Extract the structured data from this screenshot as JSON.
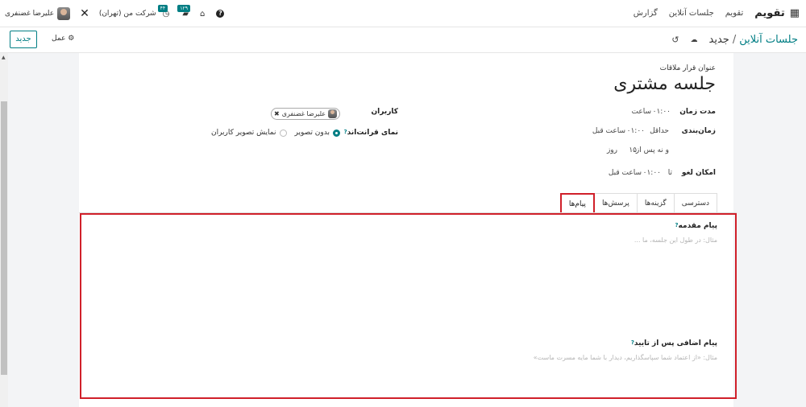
{
  "navbar": {
    "app_name": "تقویم",
    "menu": [
      "تقویم",
      "جلسات آنلاین",
      "گزارش"
    ],
    "user_name": "علیرضا غضنفری",
    "company": "شرکت من (تهران)",
    "activity_count": "۴۴",
    "messages_count": "۱۲۹"
  },
  "control": {
    "breadcrumb_parent": "جلسات آنلاین",
    "breadcrumb_sep": "/",
    "breadcrumb_current": "جدید",
    "new_label": "جدید",
    "action_label": "عمل"
  },
  "form": {
    "title_label": "عنوان قرار ملاقات",
    "title_value": "جلسه مشتری",
    "duration_label": "مدت زمان",
    "duration_value": "۰۱:۰۰",
    "duration_unit": "ساعت",
    "scheduling_label": "زمان‌بندی",
    "scheduling_min_prefix": "حداقل",
    "scheduling_min_value": "۰۱:۰۰",
    "scheduling_min_unit": "ساعت قبل",
    "scheduling_max_prefix": "و نه پس از",
    "scheduling_max_value": "۱۵",
    "scheduling_max_unit": "روز",
    "cancel_label": "امکان لغو",
    "cancel_prefix": "تا",
    "cancel_value": "۰۱:۰۰",
    "cancel_unit": "ساعت قبل",
    "users_label": "کاربران",
    "user_tag": "علیرضا غضنفری",
    "front_label": "نمای قرانت‌اند",
    "radio_no_image": "بدون تصویر",
    "radio_show_image": "نمایش تصویر کاربران"
  },
  "tabs": [
    "دسترسی",
    "گزینه‌ها",
    "پرسش‌ها",
    "پیام‌ها"
  ],
  "messages": {
    "intro_label": "پیام مقدمه",
    "intro_placeholder": "مثال: در طول این جلسه، ما ...",
    "confirm_label": "پیام اضافی پس از تایید",
    "confirm_placeholder": "مثال: «از اعتماد شما سپاسگذاریم، دیدار با شما مایه مسرت ماست»"
  }
}
